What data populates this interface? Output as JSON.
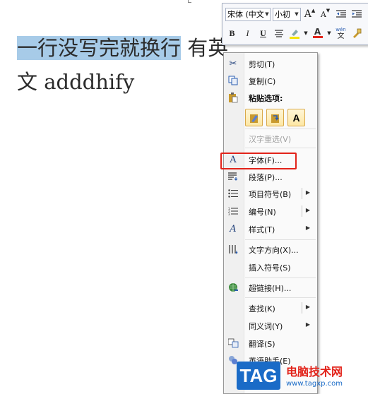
{
  "document": {
    "line1_selected": "一行没写完就换行",
    "line1_rest": "  有英",
    "line2": "文 adddhify"
  },
  "mini_toolbar": {
    "font_name": "宋体 (中文",
    "font_size": "小初",
    "grow_font": "A",
    "shrink_font": "A",
    "bold": "B",
    "italic": "I",
    "underline": "U",
    "font_color_letter": "A",
    "phonetic_top": "wén",
    "phonetic_bottom": "文"
  },
  "context_menu": {
    "cut": "剪切(T)",
    "copy": "复制(C)",
    "paste_options": "粘贴选项:",
    "paste_text_only": "A",
    "chinese_reconvert": "汉字重选(V)",
    "font": "字体(F)...",
    "paragraph": "段落(P)...",
    "bullets": "项目符号(B)",
    "numbering": "编号(N)",
    "styles": "样式(T)",
    "text_direction": "文字方向(X)...",
    "insert_symbol": "插入符号(S)",
    "hyperlink": "超链接(H)...",
    "lookup": "查找(K)",
    "synonyms": "同义词(Y)",
    "translate": "翻译(S)",
    "english_assistant": "英语助手(E)"
  },
  "watermark": {
    "tag": "TAG",
    "site_name": "电脑技术网",
    "url": "www.tagxp.com"
  },
  "colors": {
    "selection": "#a7cbe8",
    "highlight_border": "#e2231a",
    "watermark_blue": "#1a6bc7"
  }
}
